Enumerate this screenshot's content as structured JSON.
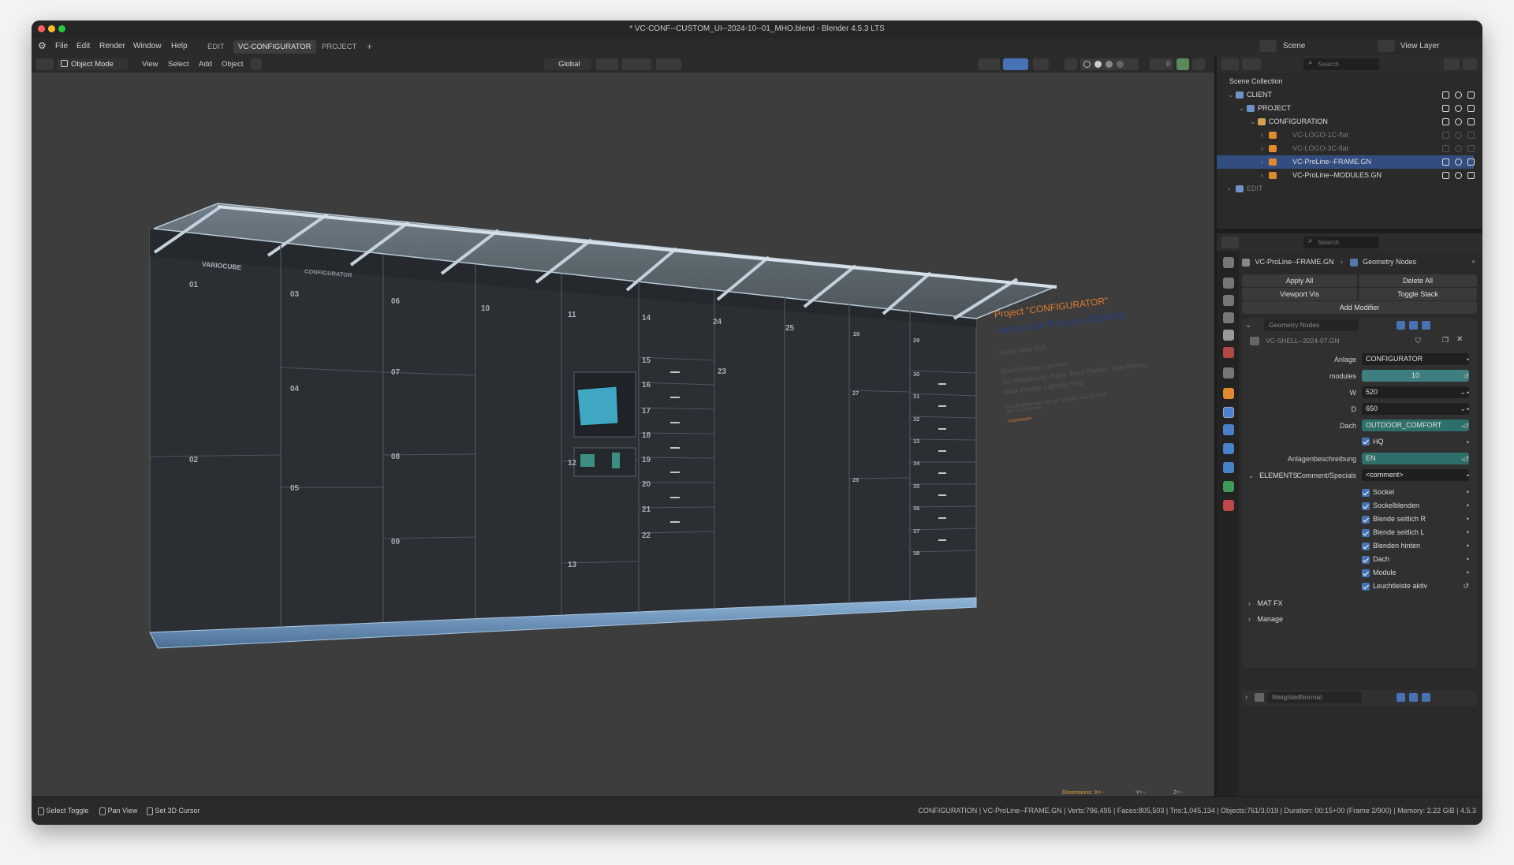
{
  "window": {
    "title": "* VC-CONF--CUSTOM_UI--2024-10--01_MHO.blend - Blender 4.5.3 LTS"
  },
  "menu": {
    "items": [
      "File",
      "Edit",
      "Render",
      "Window",
      "Help"
    ],
    "workspaces": [
      "EDIT",
      "VC-CONFIGURATOR",
      "PROJECT"
    ],
    "add_tab": "+",
    "scene": "Scene",
    "view_layer": "View Layer"
  },
  "viewport_header": {
    "mode": "Object Mode",
    "menus": [
      "View",
      "Select",
      "Add",
      "Object"
    ],
    "transform": "Global",
    "overlay_count": "0"
  },
  "scene_text": {
    "brand": "VARIOCUBE",
    "configurator": "CONFIGURATOR",
    "project": "Project \"CONFIGURATOR\"",
    "product": "Variocube ProLine 520/650",
    "finish": "Finish Mica 618",
    "roof": "Roof Outdoor Comfort",
    "modules_desc": "10 Modules inc. Base, Base Panels, Side Panels,",
    "panels_desc": "Back Panels, Lighting Strip",
    "dims": "overall dimensions for ref.: W 5080 mm | D 1035 mm | H 2170 mm",
    "comment": "<comment>",
    "locker_numbers": [
      "01",
      "02",
      "03",
      "04",
      "05",
      "06",
      "07",
      "08",
      "09",
      "10",
      "11",
      "12",
      "13",
      "14",
      "15",
      "16",
      "17",
      "18",
      "19",
      "20",
      "21",
      "22",
      "23",
      "24",
      "25",
      "26",
      "27",
      "28",
      "30",
      "31",
      "32",
      "33",
      "34",
      "35",
      "36",
      "37",
      "38",
      "29"
    ]
  },
  "outliner": {
    "search_placeholder": "Search",
    "root": "Scene Collection",
    "rows": [
      {
        "label": "CLIENT"
      },
      {
        "label": "PROJECT"
      },
      {
        "label": "CONFIGURATION"
      },
      {
        "label": "VC-LOGO-1C-flat"
      },
      {
        "label": "VC-LOGO-3C-flat"
      },
      {
        "label": "VC-ProLine--FRAME.GN"
      },
      {
        "label": "VC-ProLine--MODULES.GN"
      },
      {
        "label": "EDIT"
      }
    ]
  },
  "properties": {
    "search_placeholder": "Search",
    "breadcrumb_object": "VC-ProLine--FRAME.GN",
    "breadcrumb_modifier": "Geometry Nodes",
    "apply_all": "Apply All",
    "delete_all": "Delete All",
    "viewport_vis": "Viewport Vis",
    "toggle_stack": "Toggle Stack",
    "add_modifier": "Add Modifier",
    "modifier_name": "Geometry Nodes",
    "node_group": "VC-SHELL--2024-07.GN",
    "fields": [
      {
        "label": "Anlage",
        "value": "CONFIGURATOR"
      },
      {
        "label": "modules",
        "value": "10"
      },
      {
        "label": "W",
        "value": "520"
      },
      {
        "label": "D",
        "value": "650"
      },
      {
        "label": "Dach",
        "value": "OUTDOOR_COMFORT"
      },
      {
        "label": "",
        "value": "HQ"
      },
      {
        "label": "Anlagenbeschreibung",
        "value": "EN"
      },
      {
        "label": "Comment/Specials",
        "value": "<comment>"
      }
    ],
    "elements_header": "ELEMENTS",
    "elements": [
      "Sockel",
      "Sockelblenden",
      "Blende seitlich R",
      "Blende seitlich L",
      "Blenden hinten",
      "Dach",
      "Module",
      "Leuchtleiste aktiv"
    ],
    "mat_fx": "MAT FX",
    "manage": "Manage",
    "weighted_normal": "WeightedNormal"
  },
  "status": {
    "select": "Select Toggle",
    "pan": "Pan View",
    "cursor": "Set 3D Cursor",
    "dimensions": "Dimensions: X= -",
    "dim_y": "Y= -",
    "dim_z": "Z= -",
    "stats": "CONFIGURATION | VC-ProLine--FRAME.GN | Verts:796,495 | Faces:805,503 | Tris:1,045,134 | Objects:761/3,019 | Duration: 00:15+00 (Frame 2/900) | Memory: 2.22 GiB | 4.5.3"
  },
  "colors": {
    "accent_blue": "#4772b3",
    "selection": "#334d80",
    "orange_text": "#e07a2e",
    "teal_field": "#3d7f7f"
  }
}
